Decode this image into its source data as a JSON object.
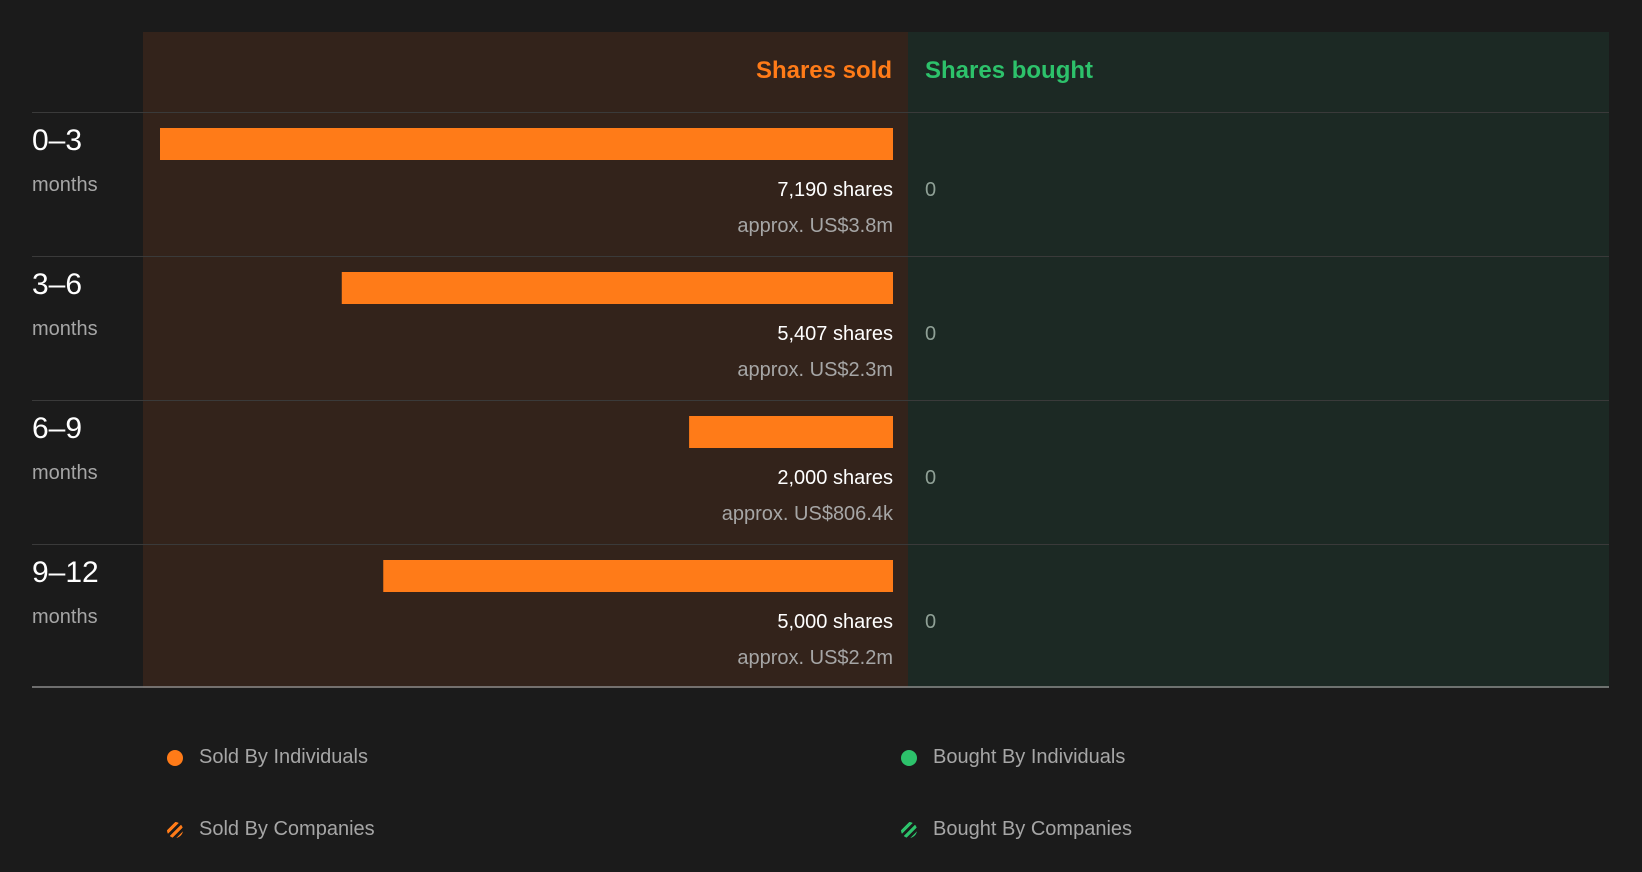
{
  "chart_data": {
    "type": "bar",
    "headers": {
      "sold": "Shares sold",
      "bought": "Shares bought"
    },
    "rows": [
      {
        "range": "0–3",
        "unit": "months",
        "sold": 7190,
        "sold_label": "7,190 shares",
        "sold_value": "approx. US$3.8m",
        "bought": 0,
        "bought_label": "0"
      },
      {
        "range": "3–6",
        "unit": "months",
        "sold": 5407,
        "sold_label": "5,407 shares",
        "sold_value": "approx. US$2.3m",
        "bought": 0,
        "bought_label": "0"
      },
      {
        "range": "6–9",
        "unit": "months",
        "sold": 2000,
        "sold_label": "2,000 shares",
        "sold_value": "approx. US$806.4k",
        "bought": 0,
        "bought_label": "0"
      },
      {
        "range": "9–12",
        "unit": "months",
        "sold": 5000,
        "sold_label": "5,000 shares",
        "sold_value": "approx. US$2.2m",
        "bought": 0,
        "bought_label": "0"
      }
    ],
    "xlim": [
      0,
      7190
    ]
  },
  "legend": [
    {
      "label": "Sold By Individuals",
      "style": "solid",
      "color": "#ff7b18"
    },
    {
      "label": "Bought By Individuals",
      "style": "solid",
      "color": "#2dc26b"
    },
    {
      "label": "Sold By Companies",
      "style": "hatched",
      "color": "#ff7b18"
    },
    {
      "label": "Bought By Companies",
      "style": "hatched",
      "color": "#2dc26b"
    }
  ],
  "colors": {
    "sold": "#ff7b18",
    "bought": "#2dc26b",
    "sold_panel": "#33231b",
    "bought_panel": "#1c2924",
    "background": "#1b1b1b",
    "muted_text": "#a6a6a6",
    "bought_zero_text": "#8fa096"
  }
}
